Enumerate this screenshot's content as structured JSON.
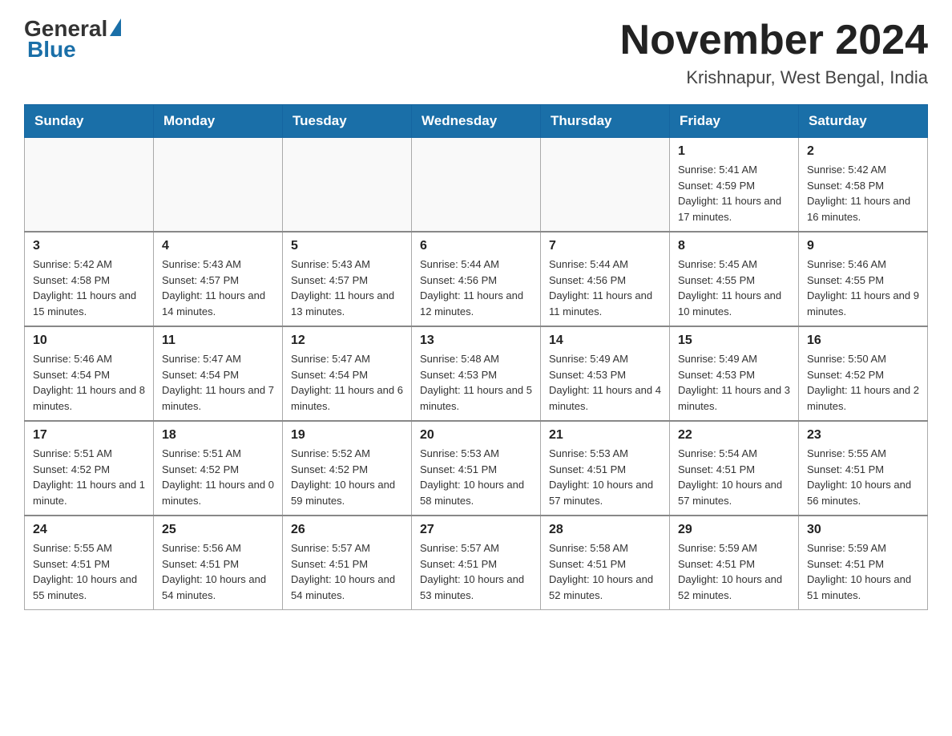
{
  "header": {
    "logo_general": "General",
    "logo_blue": "Blue",
    "title": "November 2024",
    "subtitle": "Krishnapur, West Bengal, India"
  },
  "days_of_week": [
    "Sunday",
    "Monday",
    "Tuesday",
    "Wednesday",
    "Thursday",
    "Friday",
    "Saturday"
  ],
  "weeks": [
    [
      {
        "day": "",
        "info": ""
      },
      {
        "day": "",
        "info": ""
      },
      {
        "day": "",
        "info": ""
      },
      {
        "day": "",
        "info": ""
      },
      {
        "day": "",
        "info": ""
      },
      {
        "day": "1",
        "info": "Sunrise: 5:41 AM\nSunset: 4:59 PM\nDaylight: 11 hours and 17 minutes."
      },
      {
        "day": "2",
        "info": "Sunrise: 5:42 AM\nSunset: 4:58 PM\nDaylight: 11 hours and 16 minutes."
      }
    ],
    [
      {
        "day": "3",
        "info": "Sunrise: 5:42 AM\nSunset: 4:58 PM\nDaylight: 11 hours and 15 minutes."
      },
      {
        "day": "4",
        "info": "Sunrise: 5:43 AM\nSunset: 4:57 PM\nDaylight: 11 hours and 14 minutes."
      },
      {
        "day": "5",
        "info": "Sunrise: 5:43 AM\nSunset: 4:57 PM\nDaylight: 11 hours and 13 minutes."
      },
      {
        "day": "6",
        "info": "Sunrise: 5:44 AM\nSunset: 4:56 PM\nDaylight: 11 hours and 12 minutes."
      },
      {
        "day": "7",
        "info": "Sunrise: 5:44 AM\nSunset: 4:56 PM\nDaylight: 11 hours and 11 minutes."
      },
      {
        "day": "8",
        "info": "Sunrise: 5:45 AM\nSunset: 4:55 PM\nDaylight: 11 hours and 10 minutes."
      },
      {
        "day": "9",
        "info": "Sunrise: 5:46 AM\nSunset: 4:55 PM\nDaylight: 11 hours and 9 minutes."
      }
    ],
    [
      {
        "day": "10",
        "info": "Sunrise: 5:46 AM\nSunset: 4:54 PM\nDaylight: 11 hours and 8 minutes."
      },
      {
        "day": "11",
        "info": "Sunrise: 5:47 AM\nSunset: 4:54 PM\nDaylight: 11 hours and 7 minutes."
      },
      {
        "day": "12",
        "info": "Sunrise: 5:47 AM\nSunset: 4:54 PM\nDaylight: 11 hours and 6 minutes."
      },
      {
        "day": "13",
        "info": "Sunrise: 5:48 AM\nSunset: 4:53 PM\nDaylight: 11 hours and 5 minutes."
      },
      {
        "day": "14",
        "info": "Sunrise: 5:49 AM\nSunset: 4:53 PM\nDaylight: 11 hours and 4 minutes."
      },
      {
        "day": "15",
        "info": "Sunrise: 5:49 AM\nSunset: 4:53 PM\nDaylight: 11 hours and 3 minutes."
      },
      {
        "day": "16",
        "info": "Sunrise: 5:50 AM\nSunset: 4:52 PM\nDaylight: 11 hours and 2 minutes."
      }
    ],
    [
      {
        "day": "17",
        "info": "Sunrise: 5:51 AM\nSunset: 4:52 PM\nDaylight: 11 hours and 1 minute."
      },
      {
        "day": "18",
        "info": "Sunrise: 5:51 AM\nSunset: 4:52 PM\nDaylight: 11 hours and 0 minutes."
      },
      {
        "day": "19",
        "info": "Sunrise: 5:52 AM\nSunset: 4:52 PM\nDaylight: 10 hours and 59 minutes."
      },
      {
        "day": "20",
        "info": "Sunrise: 5:53 AM\nSunset: 4:51 PM\nDaylight: 10 hours and 58 minutes."
      },
      {
        "day": "21",
        "info": "Sunrise: 5:53 AM\nSunset: 4:51 PM\nDaylight: 10 hours and 57 minutes."
      },
      {
        "day": "22",
        "info": "Sunrise: 5:54 AM\nSunset: 4:51 PM\nDaylight: 10 hours and 57 minutes."
      },
      {
        "day": "23",
        "info": "Sunrise: 5:55 AM\nSunset: 4:51 PM\nDaylight: 10 hours and 56 minutes."
      }
    ],
    [
      {
        "day": "24",
        "info": "Sunrise: 5:55 AM\nSunset: 4:51 PM\nDaylight: 10 hours and 55 minutes."
      },
      {
        "day": "25",
        "info": "Sunrise: 5:56 AM\nSunset: 4:51 PM\nDaylight: 10 hours and 54 minutes."
      },
      {
        "day": "26",
        "info": "Sunrise: 5:57 AM\nSunset: 4:51 PM\nDaylight: 10 hours and 54 minutes."
      },
      {
        "day": "27",
        "info": "Sunrise: 5:57 AM\nSunset: 4:51 PM\nDaylight: 10 hours and 53 minutes."
      },
      {
        "day": "28",
        "info": "Sunrise: 5:58 AM\nSunset: 4:51 PM\nDaylight: 10 hours and 52 minutes."
      },
      {
        "day": "29",
        "info": "Sunrise: 5:59 AM\nSunset: 4:51 PM\nDaylight: 10 hours and 52 minutes."
      },
      {
        "day": "30",
        "info": "Sunrise: 5:59 AM\nSunset: 4:51 PM\nDaylight: 10 hours and 51 minutes."
      }
    ]
  ]
}
